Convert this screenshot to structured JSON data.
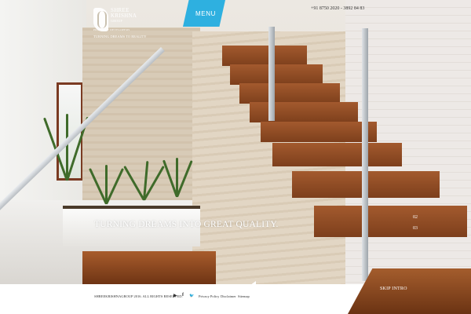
{
  "brand": {
    "name_line1": "SHREE",
    "name_line2": "KRISHNA",
    "name_line3": "GROUP",
    "subline": "PROPERTY DEVELOPERS",
    "tagline": "TURNING DREAMS TO REALITY"
  },
  "header": {
    "menu_label": "MENU",
    "phone": "+91 8750 2020 - 3892 84 83"
  },
  "hero": {
    "headline": "TURNING DREAMS INTO GREAT QUALITY.",
    "slides": [
      "02",
      "03"
    ]
  },
  "footer": {
    "copyright": "SHREEKRISHNAGROUP 2016. ALL RIGHTS RESERVED.",
    "social": [
      {
        "icon": "youtube-icon",
        "glyph": "▶"
      },
      {
        "icon": "facebook-icon",
        "glyph": "f"
      },
      {
        "icon": "twitter-icon",
        "glyph": "🐦"
      }
    ],
    "links": [
      "Privacy Policy",
      "Disclaimer",
      "Sitemap"
    ],
    "skip_intro": "SKIP INTRO"
  },
  "colors": {
    "accent": "#2eb0e0"
  }
}
